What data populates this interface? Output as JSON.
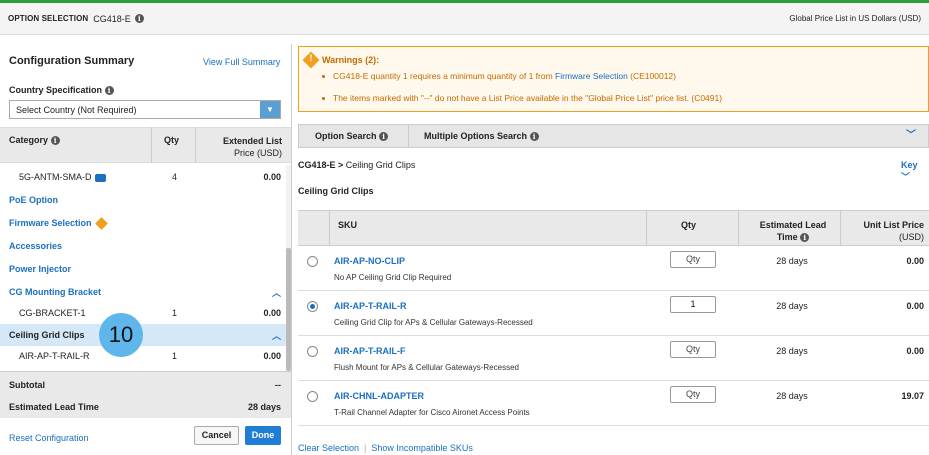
{
  "header": {
    "label": "OPTION SELECTION",
    "product": "CG418-E",
    "price_list": "Global Price List in US Dollars (USD)"
  },
  "summary": {
    "title": "Configuration Summary",
    "view_full": "View Full Summary",
    "country_label": "Country Specification",
    "country_value": "Select Country (Not Required)",
    "columns": {
      "category": "Category",
      "qty": "Qty",
      "price": "Extended List",
      "price_sub": "Price (USD)"
    },
    "rows": {
      "antenna": {
        "name": "5G-ANTM-SMA-D",
        "qty": "4",
        "price": "0.00"
      },
      "poe": "PoE Option",
      "firmware": "Firmware Selection",
      "accessories": "Accessories",
      "power": "Power Injector",
      "cg_mount": "CG Mounting Bracket",
      "bracket": {
        "name": "CG-BRACKET-1",
        "qty": "1",
        "price": "0.00"
      },
      "ceiling": "Ceiling Grid Clips",
      "clip": {
        "name": "AIR-AP-T-RAIL-R",
        "qty": "1",
        "price": "0.00"
      }
    },
    "callout": "10",
    "subtotal_label": "Subtotal",
    "subtotal_value": "--",
    "lead_label": "Estimated Lead Time",
    "lead_value": "28 days",
    "reset": "Reset Configuration",
    "cancel": "Cancel",
    "done": "Done"
  },
  "warnings": {
    "title": "Warnings (2):",
    "w1_pre": "CG418-E quantity 1 requires a minimum quantity of 1 from ",
    "w1_link": "Firmware Selection",
    "w1_post": " (CE100012)",
    "w2": "The items marked with \"--\" do not have a List Price available in the \"Global Price List\" price list. (C0491)"
  },
  "tabs": {
    "option_search": "Option Search",
    "multiple": "Multiple Options Search"
  },
  "breadcrumb": {
    "parent": "CG418-E >",
    "current": "Ceiling Grid Clips"
  },
  "key": "Key",
  "section_title": "Ceiling Grid Clips",
  "table": {
    "headers": {
      "sku": "SKU",
      "qty": "Qty",
      "lead": "Estimated Lead",
      "lead2": "Time",
      "price": "Unit List Price",
      "price_sub": "(USD)"
    },
    "rows": [
      {
        "sku": "AIR-AP-NO-CLIP",
        "desc": "No AP Ceiling Grid Clip Required",
        "qty": "Qty",
        "lead": "28 days",
        "price": "0.00"
      },
      {
        "sku": "AIR-AP-T-RAIL-R",
        "desc": "Ceiling Grid Clip for APs & Cellular Gateways-Recessed",
        "qty": "1",
        "lead": "28 days",
        "price": "0.00"
      },
      {
        "sku": "AIR-AP-T-RAIL-F",
        "desc": "Flush Mount for APs & Cellular Gateways-Recessed",
        "qty": "Qty",
        "lead": "28 days",
        "price": "0.00"
      },
      {
        "sku": "AIR-CHNL-ADAPTER",
        "desc": "T-Rail Channel Adapter for Cisco Aironet Access Points",
        "qty": "Qty",
        "lead": "28 days",
        "price": "19.07"
      }
    ],
    "clear": "Clear Selection",
    "incompat": "Show Incompatible SKUs"
  }
}
